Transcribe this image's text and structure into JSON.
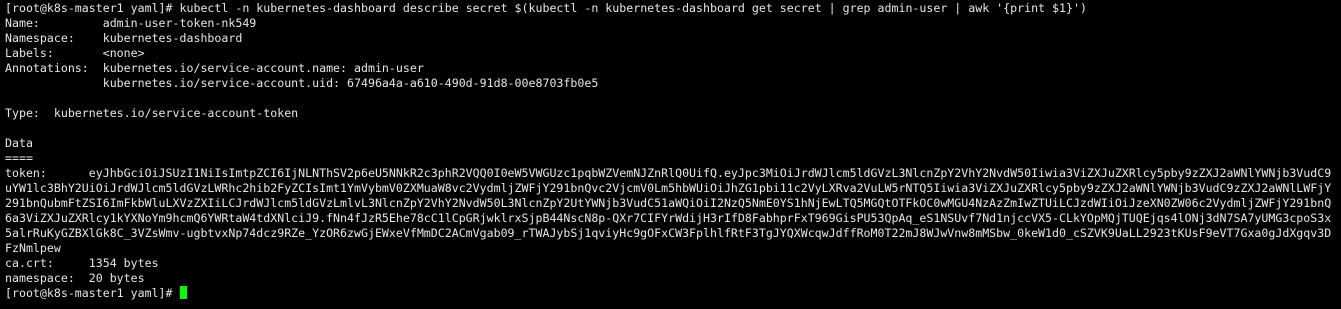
{
  "terminal": {
    "cmd1": {
      "prompt": "[root@k8s-master1 yaml]# ",
      "command": "kubectl -n kubernetes-dashboard describe secret $(kubectl -n kubernetes-dashboard get secret | grep admin-user | awk '{print $1}')"
    },
    "name_line": "Name:         admin-user-token-nk549",
    "namespace_line": "Namespace:    kubernetes-dashboard",
    "labels_line": "Labels:       <none>",
    "annotations_line1": "Annotations:  kubernetes.io/service-account.name: admin-user",
    "annotations_line2": "              kubernetes.io/service-account.uid: 67496a4a-a610-490d-91d8-00e8703fb0e5",
    "type_line": "Type:  kubernetes.io/service-account-token",
    "data_header": "Data",
    "data_separator": "====",
    "token_lines": [
      "token:      eyJhbGciOiJSUzI1NiIsImtpZCI6IjNLNThSV2p6eU5NNkR2c3phR2VQQ0I0eW5VWGUzc1pqbWZVemNJZnRlQ0UifQ.eyJpc3MiOiJrdWJlcm5ldGVzL3NlcnZpY2VhY2NvdW50Iiwia3ViZXJuZXRlcy5pby9zZXJ2aWNlYWNjb3VudC9",
      "uYW1lc3BhY2UiOiJrdWJlcm5ldGVzLWRhc2hib2FyZCIsImt1YmVybmV0ZXMuaW8vc2VydmljZWFjY291bnQvc2VjcmV0Lm5hbWUiOiJhZG1pbi11c2VyLXRva2VuLW5rNTQ5Iiwia3ViZXJuZXRlcy5pby9zZXJ2aWNlYWNjb3VudC9zZXJ2aWNlLWFjY",
      "291bnQubmFtZSI6ImFkbWluLXVzZXIiLCJrdWJlcm5ldGVzLmlvL3NlcnZpY2VhY2NvdW50L3NlcnZpY2UtYWNjb3VudC51aWQiOiI2NzQ5NmE0YS1hNjEwLTQ5MGQtOTFkOC0wMGU4NzAzZmIwZTUiLCJzdWIiOiJzeXN0ZW06c2VydmljZWFjY291bnQ",
      "6a3ViZXJuZXRlcy1kYXNoYm9hcmQ6YWRtaW4tdXNlciJ9.fNn4fJzR5Ehe78cC1lCpGRjwklrxSjpB44NscN8p-QXr7CIFYrWdijH3rIfD8FabhprFxT969GisPU53QpAq_eS1NSUvf7Nd1njccVX5-CLkYOpMQjTUQEjqs4lONj3dN7SA7yUMG3cpoS3x",
      "5alrRuKyGZBXlGk8C_3VZsWmv-ugbtvxNp74dcz9RZe_YzOR6zwGjEWxeVfMmDC2ACmVgab09_rTWAJybSj1qviyHc9gOFxCW3FplhlfRtF3TgJYQXWcqwJdffRoM0T22mJ8WJwVnw8mMSbw_0keW1d0_cSZVK9UaLL2923tKUsF9eVT7Gxa0gJdXgqv3D",
      "FzNmlpew"
    ],
    "cacrt_line": "ca.crt:     1354 bytes",
    "namespace_bytes_line": "namespace:  20 bytes",
    "prompt2": "[root@k8s-master1 yaml]# ",
    "colors": {
      "background": "#000000",
      "foreground": "#e6e6e6",
      "cursor": "#00ff00"
    }
  }
}
